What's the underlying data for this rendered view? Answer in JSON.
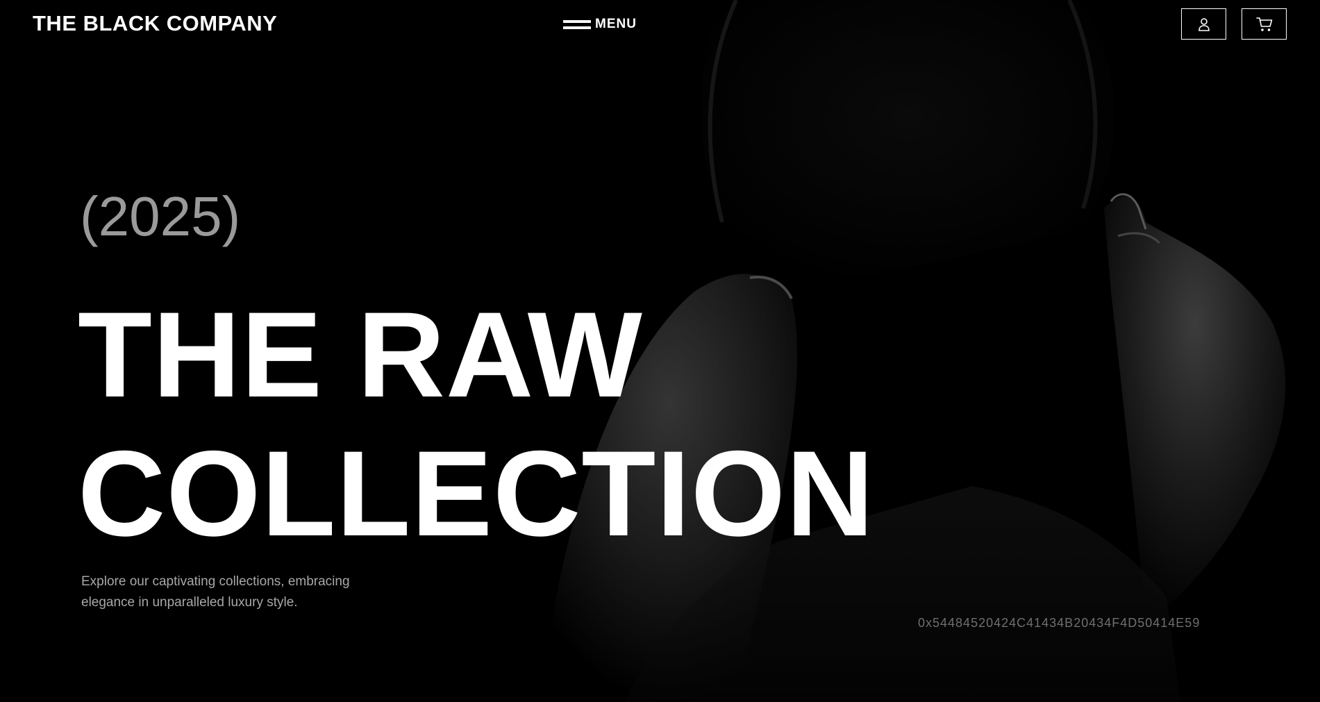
{
  "header": {
    "brand": "THE BLACK COMPANY",
    "menu_label": "MENU",
    "account_icon": "user-icon",
    "cart_icon": "cart-icon"
  },
  "hero": {
    "year": "(2025)",
    "title_line1": "THE RAW",
    "title_line2": "COLLECTION",
    "description": "Explore our captivating collections, embracing elegance in unparalleled luxury style.",
    "code": "0x54484520424C41434B20434F4D50414E59"
  },
  "colors": {
    "background": "#000000",
    "text": "#ffffff",
    "muted": "#9a9a9a",
    "code": "#6f6f6f"
  }
}
